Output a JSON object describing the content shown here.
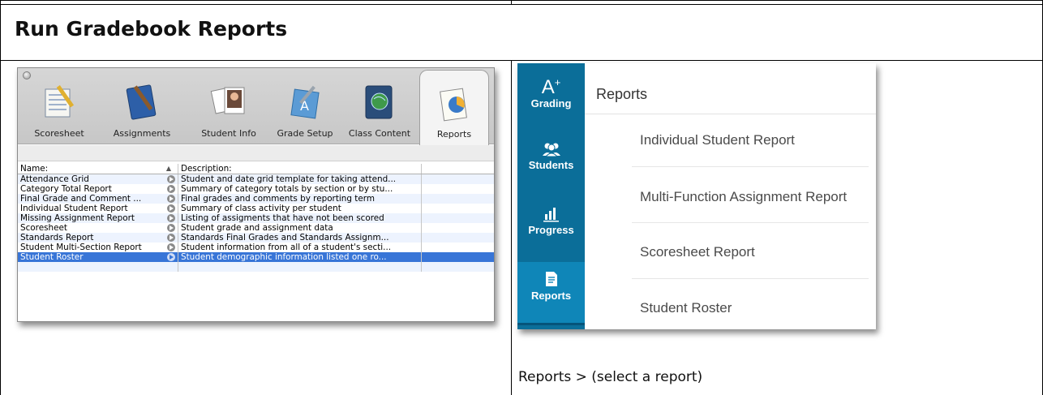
{
  "heading": "Run Gradebook Reports",
  "desktop_app": {
    "toolbar": [
      {
        "label": "Scoresheet",
        "icon": "scoresheet-icon"
      },
      {
        "label": "Assignments",
        "icon": "assignments-icon"
      },
      {
        "label": "Student Info",
        "icon": "student-info-icon"
      },
      {
        "label": "Grade Setup",
        "icon": "grade-setup-icon"
      },
      {
        "label": "Class Content",
        "icon": "class-content-icon"
      },
      {
        "label": "Reports",
        "icon": "reports-icon",
        "active": true
      }
    ],
    "table": {
      "columns": [
        "Name:",
        "Description:"
      ],
      "rows": [
        {
          "name": "Attendance Grid",
          "description": "Student and date grid template for taking attend..."
        },
        {
          "name": "Category Total Report",
          "description": "Summary of category totals by section or by stu..."
        },
        {
          "name": "Final Grade and Comment ...",
          "description": "Final grades and comments by reporting term"
        },
        {
          "name": "Individual Student Report",
          "description": "Summary of class activity per student"
        },
        {
          "name": "Missing Assignment Report",
          "description": "Listing of assigments that have not been scored"
        },
        {
          "name": "Scoresheet",
          "description": "Student grade and assignment data"
        },
        {
          "name": "Standards Report",
          "description": "Standards Final Grades and Standards Assignm..."
        },
        {
          "name": "Student Multi-Section Report",
          "description": "Student information from all of a student's secti..."
        },
        {
          "name": "Student Roster",
          "description": "Student demographic information listed one ro...",
          "selected": true
        }
      ]
    }
  },
  "web_app": {
    "nav": [
      {
        "label": "Grading",
        "icon": "grading-icon",
        "glyph": "A",
        "sup": "+"
      },
      {
        "label": "Students",
        "icon": "students-icon"
      },
      {
        "label": "Progress",
        "icon": "progress-icon"
      },
      {
        "label": "Reports",
        "icon": "reports-icon",
        "active": true
      }
    ],
    "title": "Reports",
    "reports": [
      "Individual Student Report",
      "Multi-Function Assignment Report",
      "Scoresheet Report",
      "Student Roster"
    ]
  },
  "caption": "Reports > (select a report)",
  "colors": {
    "selection": "#3875d7",
    "sidebar": "#0b6e99",
    "sidebar_active": "#0f86b8",
    "row_stripe": "#edf3fe"
  }
}
